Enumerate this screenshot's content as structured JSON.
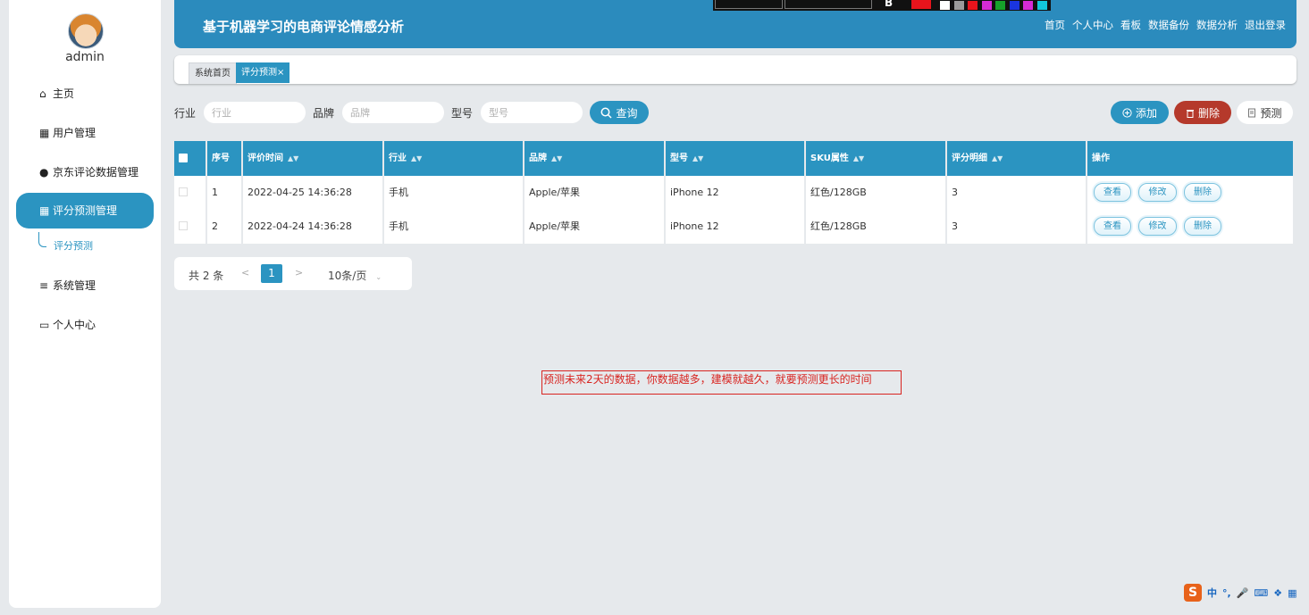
{
  "sidebar": {
    "username": "admin",
    "items": [
      {
        "label": "主页",
        "icon": "home-icon",
        "glyph": "⌂"
      },
      {
        "label": "用户管理",
        "icon": "grid-icon",
        "glyph": "▦"
      },
      {
        "label": "京东评论数据管理",
        "icon": "user-icon",
        "glyph": "●"
      },
      {
        "label": "评分预测管理",
        "icon": "grid-icon",
        "glyph": "▦"
      },
      {
        "label": "系统管理",
        "icon": "list-icon",
        "glyph": "≡"
      },
      {
        "label": "个人中心",
        "icon": "card-icon",
        "glyph": "▭"
      }
    ],
    "submenu_label": "评分预测"
  },
  "header": {
    "title": "基于机器学习的电商评论情感分析",
    "nav": [
      "首页",
      "个人中心",
      "看板",
      "数据备份",
      "数据分析",
      "退出登录"
    ]
  },
  "overlay": {
    "swatches": [
      "#ffffff",
      "#9a9a9a",
      "#e8141c",
      "#d52bd6",
      "#16a12a",
      "#1a35e0",
      "#d52bd6",
      "#12c6d9"
    ]
  },
  "tabs": {
    "home": "系统首页",
    "current": "评分预测",
    "close": "×"
  },
  "search": {
    "fields": [
      {
        "label": "行业",
        "placeholder": "行业"
      },
      {
        "label": "品牌",
        "placeholder": "品牌"
      },
      {
        "label": "型号",
        "placeholder": "型号"
      }
    ],
    "query_label": "查询"
  },
  "actions": {
    "add": "添加",
    "delete": "删除",
    "predict": "预测"
  },
  "table": {
    "columns": [
      "序号",
      "评价时间",
      "行业",
      "品牌",
      "型号",
      "SKU属性",
      "评分明细",
      "操作"
    ],
    "rows": [
      {
        "index": "1",
        "time": "2022-04-25 14:36:28",
        "industry": "手机",
        "brand": "Apple/苹果",
        "model": "iPhone 12",
        "sku": "红色/128GB",
        "score": "3"
      },
      {
        "index": "2",
        "time": "2022-04-24 14:36:28",
        "industry": "手机",
        "brand": "Apple/苹果",
        "model": "iPhone 12",
        "sku": "红色/128GB",
        "score": "3"
      }
    ],
    "row_actions": {
      "view": "查看",
      "edit": "修改",
      "delete": "删除"
    }
  },
  "pagination": {
    "total": "共 2 条",
    "prev": "<",
    "page": "1",
    "next": ">",
    "page_size": "10条/页"
  },
  "annotation": "预测未来2天的数据，你数据越多，建模就越久，就要预测更长的时间",
  "ime": {
    "logo": "S",
    "mode": "中"
  },
  "colors": {
    "primary": "#2b94c1",
    "danger": "#b5392b",
    "annotation": "#d82420"
  }
}
